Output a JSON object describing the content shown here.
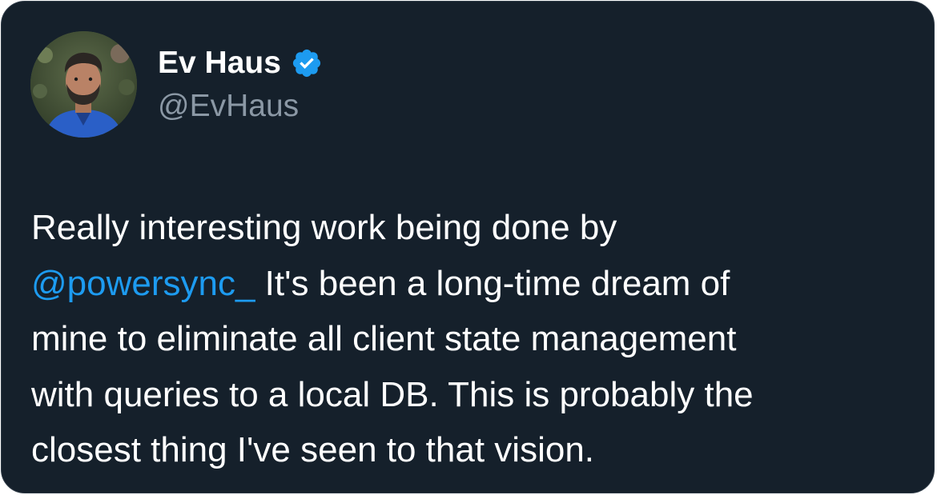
{
  "author": {
    "name": "Ev Haus",
    "handle": "@EvHaus",
    "verified": true,
    "avatar_icon": "profile-photo"
  },
  "tweet": {
    "line1": "Really interesting work being done by",
    "mention": "@powersync_",
    "line2_rest": " It's been a long-time dream of",
    "line3": "mine to eliminate all client state management",
    "line4": "with queries to a local DB. This is probably the",
    "line5": "closest thing I've seen to that vision."
  },
  "colors": {
    "background": "#15202b",
    "text": "#ffffff",
    "secondary_text": "#8b98a5",
    "link": "#1d9bf0",
    "verified_badge": "#1d9bf0"
  }
}
